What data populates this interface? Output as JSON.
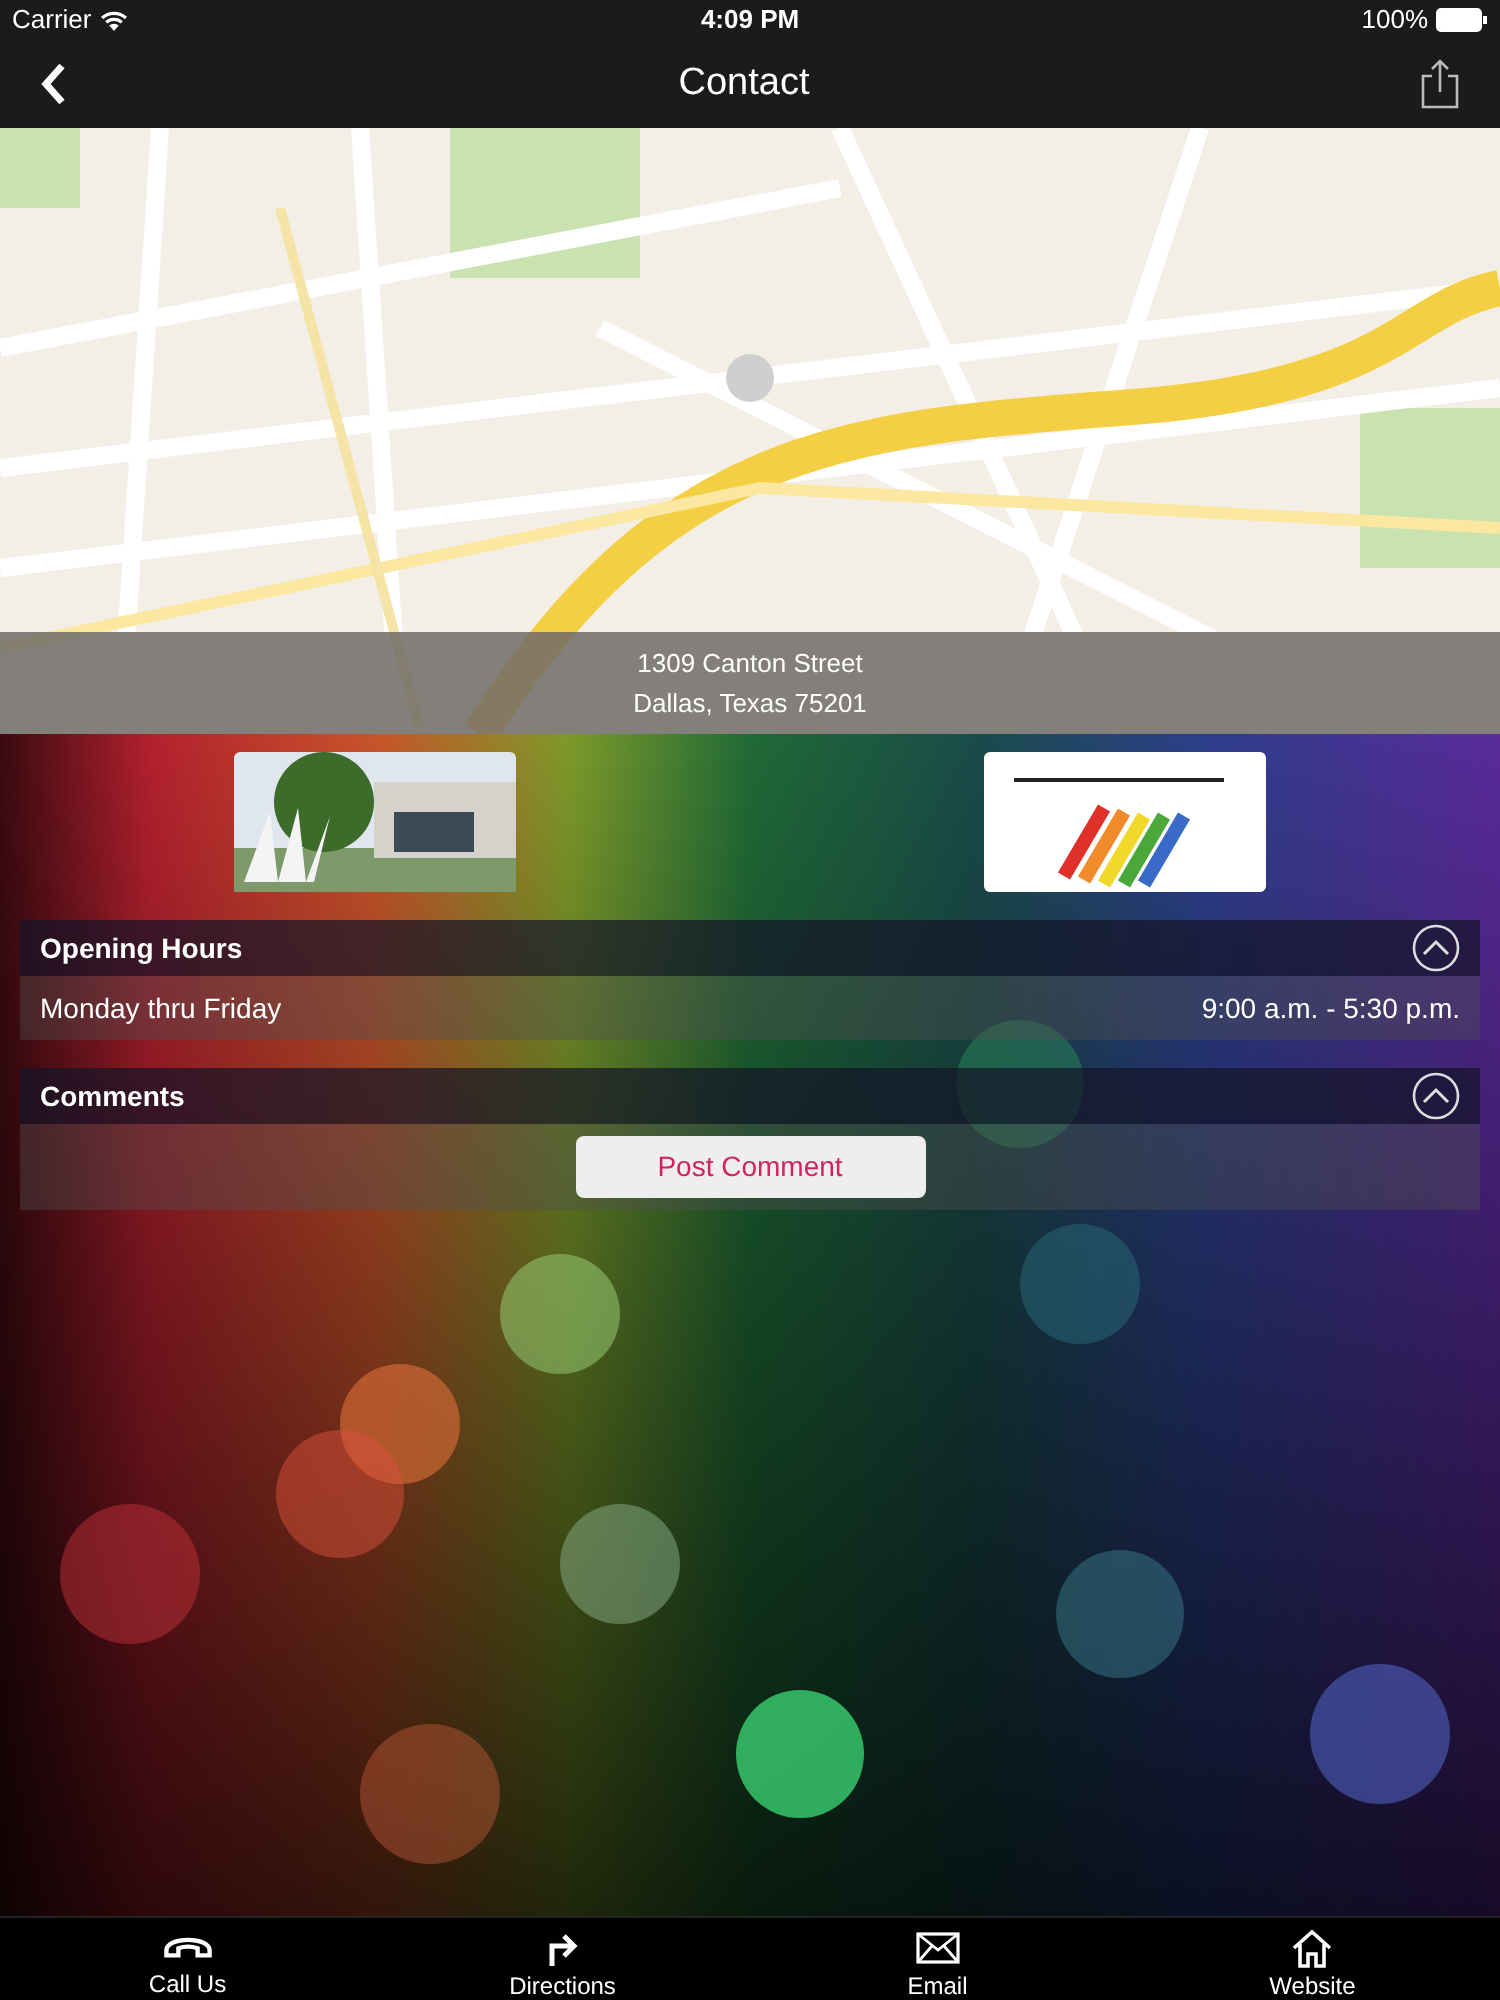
{
  "status_bar": {
    "carrier": "Carrier",
    "time": "4:09 PM",
    "battery": "100%"
  },
  "nav_bar": {
    "title": "Contact"
  },
  "map": {
    "address": [
      "1309 Canton Street",
      "Dallas, Texas 75201"
    ]
  },
  "sections": [
    {
      "title": "Opening Hours",
      "expanded": true,
      "rows": [
        {
          "label": "Monday thru Friday",
          "value": "9:00 a.m. - 5:30 p.m."
        }
      ]
    },
    {
      "title": "Comments",
      "expanded": true,
      "button": "Post Comment"
    }
  ],
  "tab_bar": [
    {
      "kind": "phone",
      "label": "Call Us"
    },
    {
      "kind": "directions",
      "label": "Directions"
    },
    {
      "kind": "email",
      "label": "Email"
    },
    {
      "kind": "home",
      "label": "Website"
    }
  ]
}
